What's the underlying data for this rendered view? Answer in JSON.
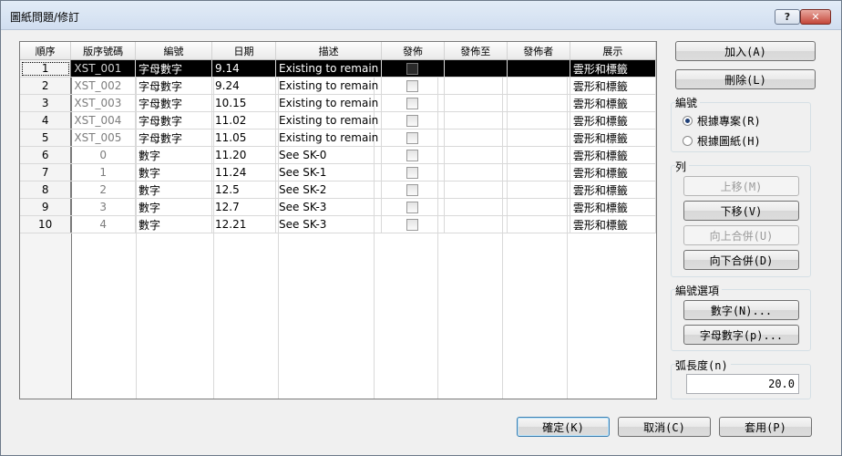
{
  "window": {
    "title": "圖紙問題/修訂",
    "help_label": "?",
    "close_label": "✕"
  },
  "grid": {
    "columns": [
      "順序",
      "版序號碼",
      "編號",
      "日期",
      "描述",
      "發佈",
      "發佈至",
      "發佈者",
      "展示"
    ],
    "rows": [
      {
        "seq": "1",
        "revision": "XST_001",
        "numbering": "字母數字",
        "date": "9.14",
        "description": "Existing to remain",
        "issued": false,
        "issued_to": "",
        "issued_by": "",
        "show": "雲形和標籤"
      },
      {
        "seq": "2",
        "revision": "XST_002",
        "numbering": "字母數字",
        "date": "9.24",
        "description": "Existing to remain",
        "issued": false,
        "issued_to": "",
        "issued_by": "",
        "show": "雲形和標籤"
      },
      {
        "seq": "3",
        "revision": "XST_003",
        "numbering": "字母數字",
        "date": "10.15",
        "description": "Existing to remain",
        "issued": false,
        "issued_to": "",
        "issued_by": "",
        "show": "雲形和標籤"
      },
      {
        "seq": "4",
        "revision": "XST_004",
        "numbering": "字母數字",
        "date": "11.02",
        "description": "Existing to remain",
        "issued": false,
        "issued_to": "",
        "issued_by": "",
        "show": "雲形和標籤"
      },
      {
        "seq": "5",
        "revision": "XST_005",
        "numbering": "字母數字",
        "date": "11.05",
        "description": "Existing to remain",
        "issued": false,
        "issued_to": "",
        "issued_by": "",
        "show": "雲形和標籤"
      },
      {
        "seq": "6",
        "revision": "0",
        "numbering": "數字",
        "date": "11.20",
        "description": "See SK-0",
        "issued": false,
        "issued_to": "",
        "issued_by": "",
        "show": "雲形和標籤"
      },
      {
        "seq": "7",
        "revision": "1",
        "numbering": "數字",
        "date": "11.24",
        "description": "See SK-1",
        "issued": false,
        "issued_to": "",
        "issued_by": "",
        "show": "雲形和標籤"
      },
      {
        "seq": "8",
        "revision": "2",
        "numbering": "數字",
        "date": "12.5",
        "description": "See SK-2",
        "issued": false,
        "issued_to": "",
        "issued_by": "",
        "show": "雲形和標籤"
      },
      {
        "seq": "9",
        "revision": "3",
        "numbering": "數字",
        "date": "12.7",
        "description": "See SK-3",
        "issued": false,
        "issued_to": "",
        "issued_by": "",
        "show": "雲形和標籤"
      },
      {
        "seq": "10",
        "revision": "4",
        "numbering": "數字",
        "date": "12.21",
        "description": "See SK-3",
        "issued": false,
        "issued_to": "",
        "issued_by": "",
        "show": "雲形和標籤"
      }
    ],
    "selected_row": 0
  },
  "side": {
    "add_label": "加入(A)",
    "delete_label": "刪除(L)",
    "numbering_group": "編號",
    "per_project_label": "根據專案(R)",
    "per_sheet_label": "根據圖紙(H)",
    "per_project_selected": true,
    "row_group": "列",
    "move_up_label": "上移(M)",
    "move_down_label": "下移(V)",
    "merge_up_label": "向上合併(U)",
    "merge_down_label": "向下合併(D)",
    "numbering_options_group": "編號選項",
    "numeric_label": "數字(N)...",
    "alphanumeric_label": "字母數字(p)...",
    "arc_length_group": "弧長度(n)",
    "arc_length_value": "20.0"
  },
  "footer": {
    "ok_label": "確定(K)",
    "cancel_label": "取消(C)",
    "apply_label": "套用(P)"
  }
}
